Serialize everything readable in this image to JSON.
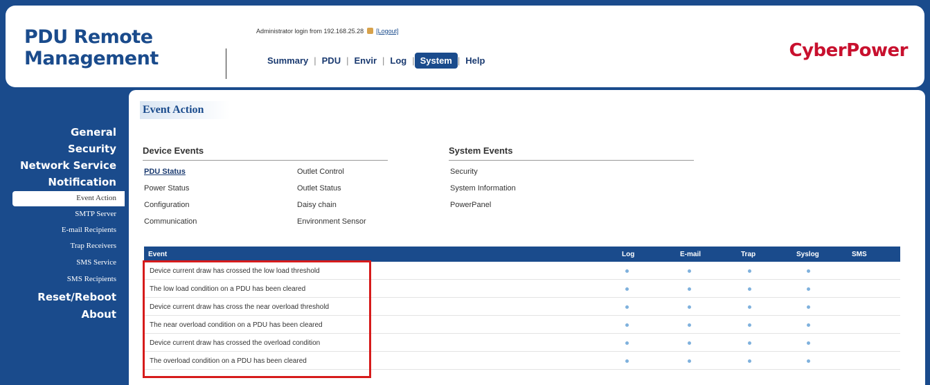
{
  "header": {
    "brand_line1": "PDU Remote",
    "brand_line2": "Management",
    "admin_text": "Administrator login from 192.168.25.28",
    "logout_label": "[Logout]",
    "logo": "CyberPower",
    "nav": [
      "Summary",
      "PDU",
      "Envir",
      "Log",
      "System",
      "Help"
    ],
    "active_nav": "System"
  },
  "sidebar": {
    "items": [
      {
        "label": "General",
        "type": "major"
      },
      {
        "label": "Security",
        "type": "major"
      },
      {
        "label": "Network Service",
        "type": "major"
      },
      {
        "label": "Notification",
        "type": "major"
      },
      {
        "label": "Event Action",
        "type": "minor",
        "active": true
      },
      {
        "label": "SMTP Server",
        "type": "minor"
      },
      {
        "label": "E-mail Recipients",
        "type": "minor"
      },
      {
        "label": "Trap Receivers",
        "type": "minor"
      },
      {
        "label": "SMS Service",
        "type": "minor"
      },
      {
        "label": "SMS Recipients",
        "type": "minor"
      },
      {
        "label": "Reset/Reboot",
        "type": "major"
      },
      {
        "label": "About",
        "type": "major"
      }
    ]
  },
  "main": {
    "title": "Event Action",
    "device_events": {
      "heading": "Device Events",
      "col1": [
        "PDU Status",
        "Power Status",
        "Configuration",
        "Communication"
      ],
      "col2": [
        "Outlet Control",
        "Outlet Status",
        "Daisy chain",
        "Environment Sensor"
      ],
      "current": "PDU Status"
    },
    "system_events": {
      "heading": "System Events",
      "items": [
        "Security",
        "System Information",
        "PowerPanel"
      ]
    },
    "table": {
      "columns": [
        "Event",
        "Log",
        "E-mail",
        "Trap",
        "Syslog",
        "SMS"
      ],
      "rows": [
        {
          "event": "Device current draw has crossed the low load threshold",
          "log": true,
          "email": true,
          "trap": true,
          "syslog": true,
          "sms": false
        },
        {
          "event": "The low load condition on a PDU has been cleared",
          "log": true,
          "email": true,
          "trap": true,
          "syslog": true,
          "sms": false
        },
        {
          "event": "Device current draw has cross the near overload threshold",
          "log": true,
          "email": true,
          "trap": true,
          "syslog": true,
          "sms": false
        },
        {
          "event": "The near overload condition on a PDU has been cleared",
          "log": true,
          "email": true,
          "trap": true,
          "syslog": true,
          "sms": false
        },
        {
          "event": "Device current draw has crossed the overload condition",
          "log": true,
          "email": true,
          "trap": true,
          "syslog": true,
          "sms": false
        },
        {
          "event": "The overload condition on a PDU has been cleared",
          "log": true,
          "email": true,
          "trap": true,
          "syslog": true,
          "sms": false
        }
      ]
    }
  },
  "colors": {
    "brand_blue": "#1a4b8c",
    "logo_red": "#c8102e",
    "highlight_red": "#d61b1b",
    "dot_blue": "#7fb1dd"
  }
}
